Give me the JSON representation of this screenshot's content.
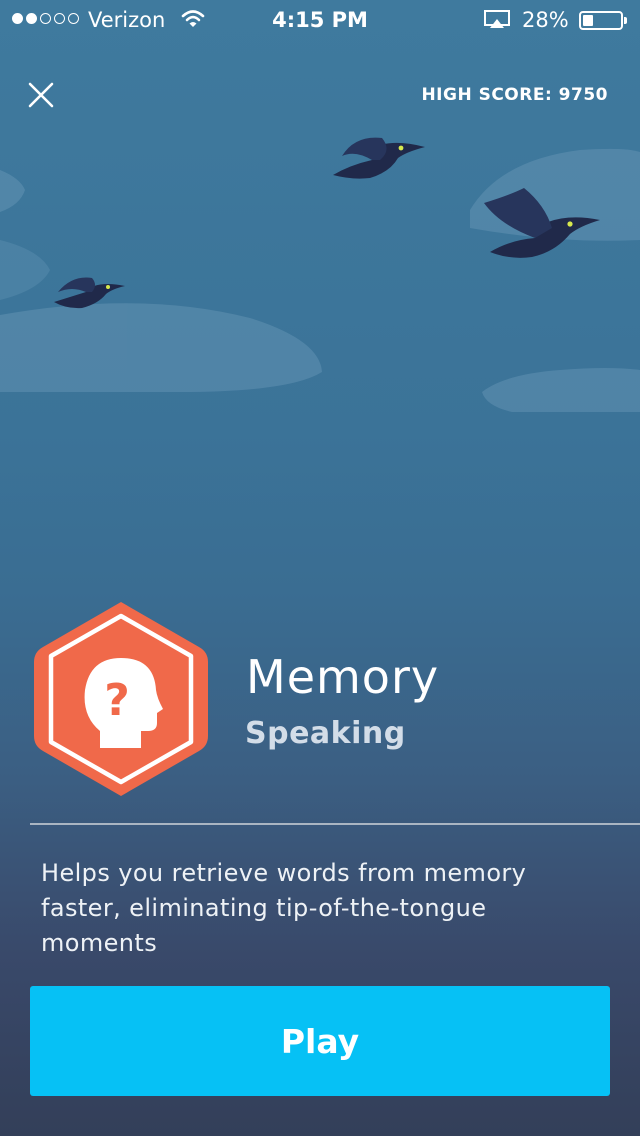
{
  "status_bar": {
    "signal_bars_filled": 2,
    "signal_bars_total": 5,
    "carrier": "Verizon",
    "time": "4:15 PM",
    "battery_percent": "28%",
    "battery_level": 0.28
  },
  "header": {
    "close_icon": "close-icon",
    "high_score_label": "HIGH SCORE: 9750"
  },
  "game": {
    "title": "Memory",
    "category": "Speaking",
    "icon": "brain-question-icon",
    "description": "Helps you retrieve words from memory faster, eliminating tip-of-the-tongue moments",
    "play_label": "Play"
  },
  "colors": {
    "badge": "#f0694a",
    "play_button": "#06c1f5",
    "sky_top": "#3f7a9e",
    "sky_bottom": "#333f59"
  }
}
